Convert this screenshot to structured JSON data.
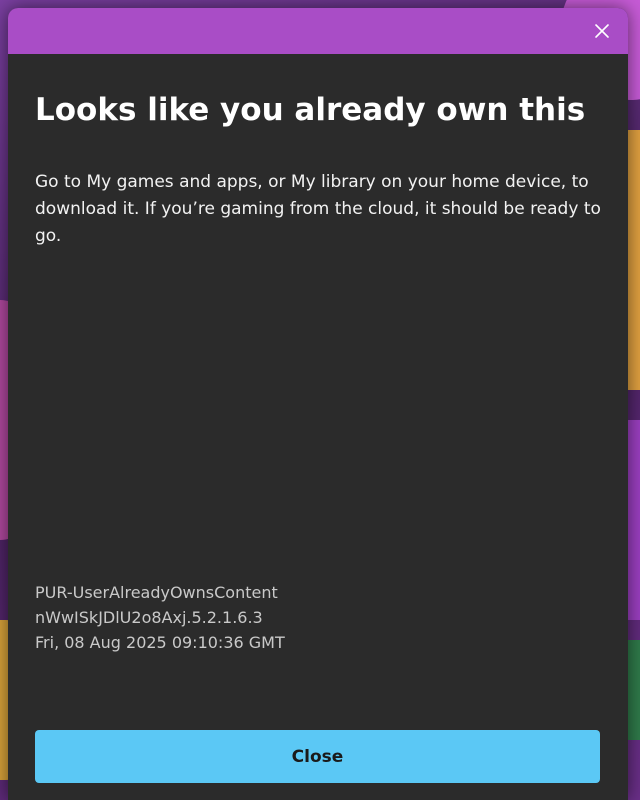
{
  "dialog": {
    "title": "Looks like you already own this",
    "message": "Go to My games and apps, or My library on your home device, to download it. If you’re gaming from the cloud, it should be ready to go.",
    "error_code": "PUR-UserAlreadyOwnsContent",
    "correlation_id": "nWwISkJDlU2o8Axj.5.2.1.6.3",
    "timestamp": "Fri, 08 Aug 2025 09:10:36 GMT",
    "close_label": "Close",
    "close_icon": "close-icon"
  },
  "colors": {
    "titlebar": "#a94dc6",
    "panel": "#2b2b2b",
    "button": "#5bc8f5"
  }
}
